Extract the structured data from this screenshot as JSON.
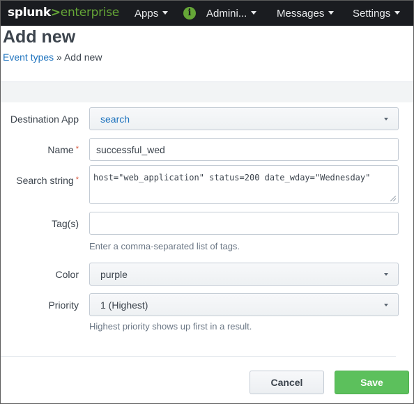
{
  "topbar": {
    "logo": {
      "brand": "splunk",
      "sep": ">",
      "product": "enterprise"
    },
    "nav": {
      "apps": "Apps",
      "admin": "Admini...",
      "messages": "Messages",
      "settings": "Settings"
    },
    "info_icon": "i"
  },
  "header": {
    "title": "Add new",
    "breadcrumb": {
      "link": "Event types",
      "sep": " » ",
      "current": "Add new"
    }
  },
  "form": {
    "destination_app": {
      "label": "Destination App",
      "value": "search"
    },
    "name": {
      "label": "Name",
      "required_mark": "*",
      "value": "successful_wed"
    },
    "search_string": {
      "label": "Search string",
      "required_mark": "*",
      "value": "host=\"web_application\" status=200 date_wday=\"Wednesday\""
    },
    "tags": {
      "label": "Tag(s)",
      "value": "",
      "help": "Enter a comma-separated list of tags."
    },
    "color": {
      "label": "Color",
      "value": "purple"
    },
    "priority": {
      "label": "Priority",
      "value": "1 (Highest)",
      "help": "Highest priority shows up first in a result."
    }
  },
  "buttons": {
    "cancel": "Cancel",
    "save": "Save"
  },
  "colors": {
    "topbar": "#1a1c20",
    "brand_green": "#65a637",
    "save_green": "#5cc05c",
    "link_blue": "#1e73be"
  }
}
